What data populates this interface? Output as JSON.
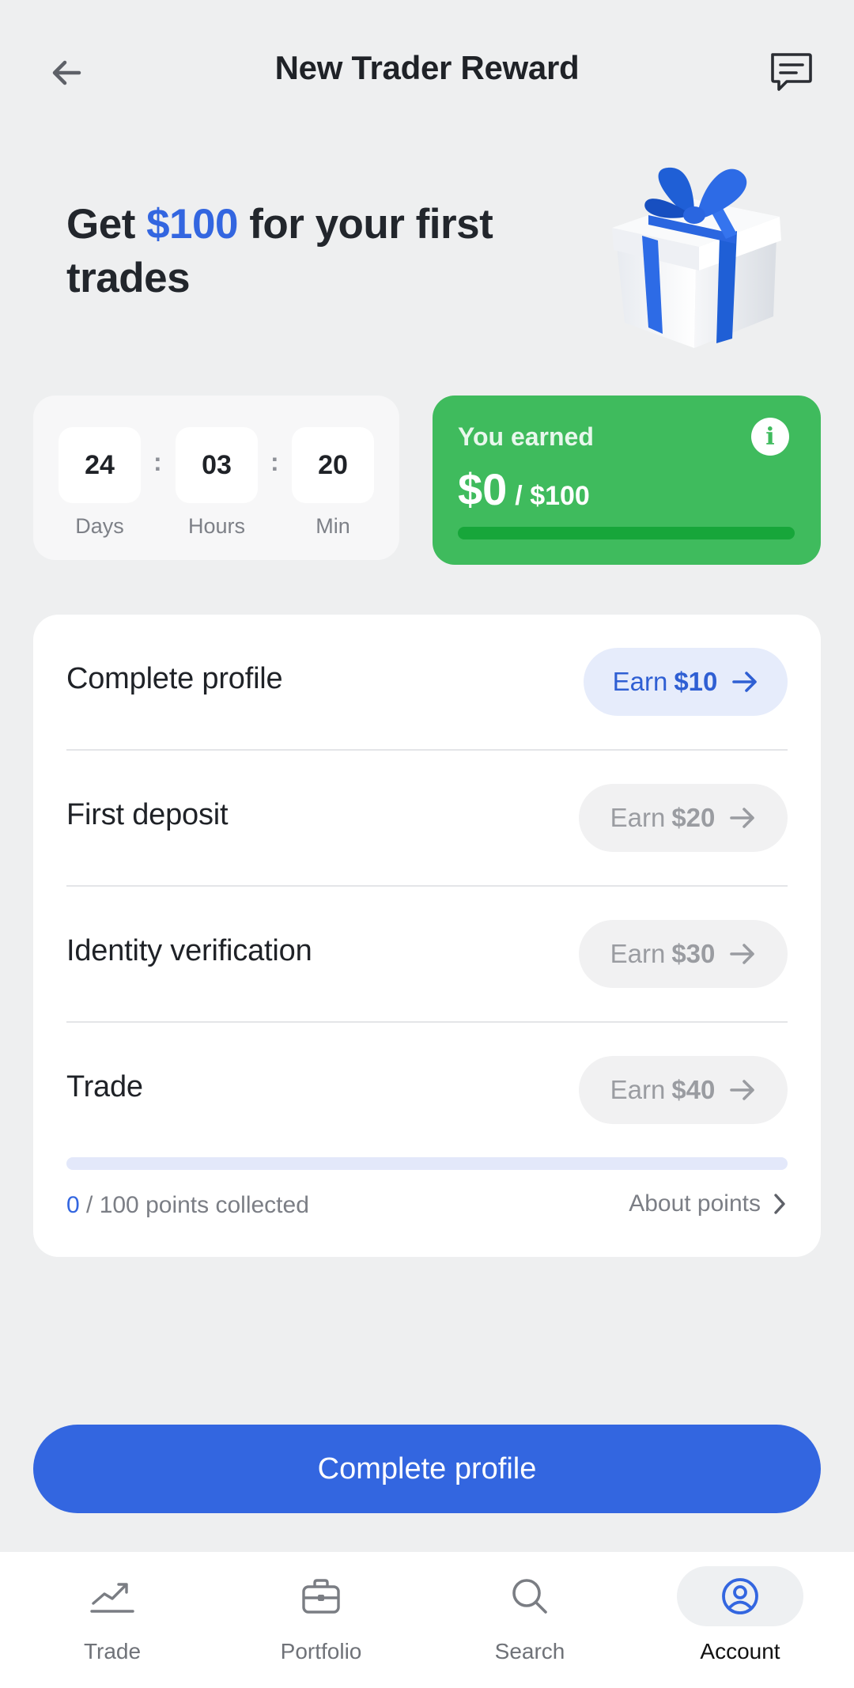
{
  "header": {
    "title": "New Trader Reward"
  },
  "hero": {
    "prefix": "Get ",
    "amount": "$100",
    "suffix": " for your first trades"
  },
  "countdown": {
    "days": {
      "value": "24",
      "label": "Days"
    },
    "hours": {
      "value": "03",
      "label": "Hours"
    },
    "minutes": {
      "value": "20",
      "label": "Min"
    },
    "separator": ":"
  },
  "earned": {
    "label": "You earned",
    "value": "$0",
    "total": "/ $100",
    "progress_fraction": 0,
    "info_icon": "info-icon"
  },
  "tasks": [
    {
      "label": "Complete profile",
      "earn_word": "Earn",
      "amount": "$10",
      "active": true
    },
    {
      "label": "First deposit",
      "earn_word": "Earn",
      "amount": "$20",
      "active": false
    },
    {
      "label": "Identity verification",
      "earn_word": "Earn",
      "amount": "$30",
      "active": false
    },
    {
      "label": "Trade",
      "earn_word": "Earn",
      "amount": "$40",
      "active": false
    }
  ],
  "points": {
    "collected": "0",
    "suffix": " / 100 points collected",
    "progress_fraction": 0,
    "about_label": "About points"
  },
  "cta": {
    "label": "Complete profile"
  },
  "nav": [
    {
      "label": "Trade",
      "icon": "chart-line-icon",
      "active": false
    },
    {
      "label": "Portfolio",
      "icon": "briefcase-icon",
      "active": false
    },
    {
      "label": "Search",
      "icon": "search-icon",
      "active": false
    },
    {
      "label": "Account",
      "icon": "user-circle-icon",
      "active": true
    }
  ],
  "colors": {
    "accent": "#3366e0",
    "success": "#3fbb5d",
    "background": "#eeeff0"
  }
}
